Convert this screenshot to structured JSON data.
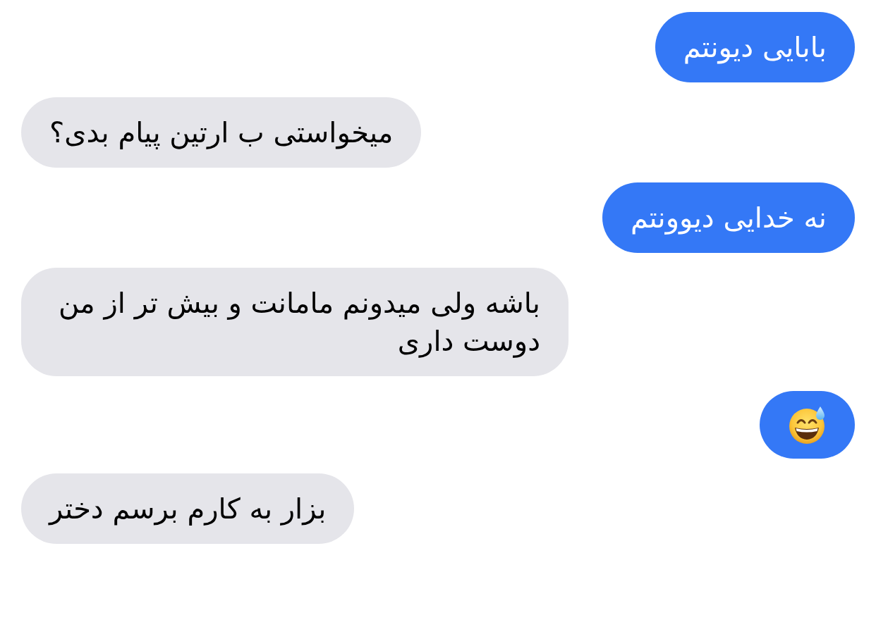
{
  "messages": [
    {
      "outgoing": true,
      "kind": "text",
      "text": "بابایی دیونتم"
    },
    {
      "outgoing": false,
      "kind": "text",
      "text": "میخواستی ب ارتین پیام بدی؟"
    },
    {
      "outgoing": true,
      "kind": "text",
      "text": "نه خدایی دیوونتم"
    },
    {
      "outgoing": false,
      "kind": "text",
      "text": "باشه ولی میدونم مامانت و بیش تر از من دوست داری"
    },
    {
      "outgoing": true,
      "kind": "emoji"
    },
    {
      "outgoing": false,
      "kind": "text",
      "text": "بزار به کارم برسم دختر"
    }
  ]
}
